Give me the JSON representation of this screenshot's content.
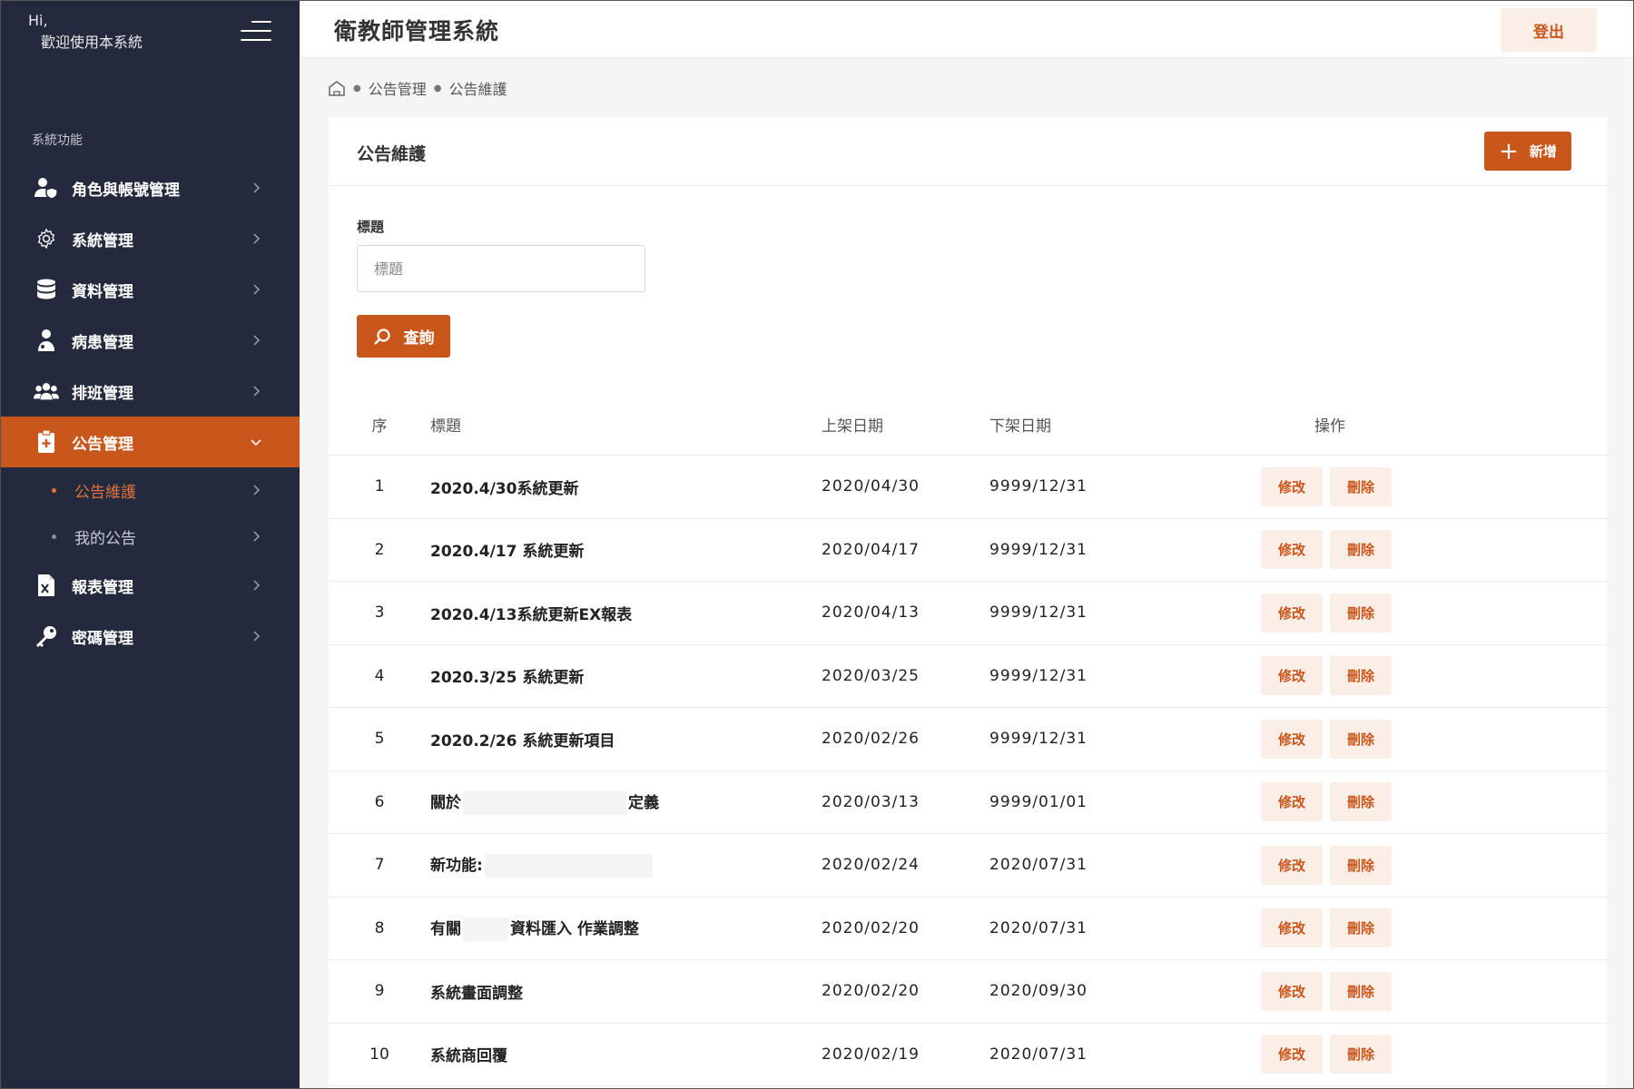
{
  "sidebar": {
    "greeting_line1": "Hi,",
    "greeting_line2": "歡迎使用本系統",
    "section_label": "系統功能",
    "items": [
      {
        "label": "角色與帳號管理",
        "icon": "user-shield-icon"
      },
      {
        "label": "系統管理",
        "icon": "gear-icon"
      },
      {
        "label": "資料管理",
        "icon": "database-icon"
      },
      {
        "label": "病患管理",
        "icon": "patient-icon"
      },
      {
        "label": "排班管理",
        "icon": "users-icon"
      },
      {
        "label": "公告管理",
        "icon": "clipboard-plus-icon"
      },
      {
        "label": "報表管理",
        "icon": "excel-file-icon"
      },
      {
        "label": "密碼管理",
        "icon": "key-icon"
      }
    ],
    "subitems": [
      {
        "label": "公告維護"
      },
      {
        "label": "我的公告"
      }
    ]
  },
  "header": {
    "title": "衛教師管理系統",
    "logout_label": "登出"
  },
  "breadcrumb": {
    "items": [
      "公告管理",
      "公告維護"
    ]
  },
  "card": {
    "title": "公告維護",
    "add_label": "新增",
    "field_label": "標題",
    "input_placeholder": "標題",
    "search_label": "查詢"
  },
  "table": {
    "headers": [
      "序",
      "標題",
      "上架日期",
      "下架日期",
      "操作"
    ],
    "edit_label": "修改",
    "delete_label": "刪除",
    "rows": [
      {
        "no": "1",
        "title_a": "2020.4/30系統更新",
        "title_b": "",
        "start": "2020/04/30",
        "end": "9999/12/31"
      },
      {
        "no": "2",
        "title_a": "2020.4/17 系統更新",
        "title_b": "",
        "start": "2020/04/17",
        "end": "9999/12/31"
      },
      {
        "no": "3",
        "title_a": "2020.4/13系統更新EX報表",
        "title_b": "",
        "start": "2020/04/13",
        "end": "9999/12/31"
      },
      {
        "no": "4",
        "title_a": "2020.3/25 系統更新",
        "title_b": "",
        "start": "2020/03/25",
        "end": "9999/12/31"
      },
      {
        "no": "5",
        "title_a": "2020.2/26 系統更新項目",
        "title_b": "",
        "start": "2020/02/26",
        "end": "9999/12/31"
      },
      {
        "no": "6",
        "title_a": "關於",
        "title_b": "定義",
        "start": "2020/03/13",
        "end": "9999/01/01"
      },
      {
        "no": "7",
        "title_a": "新功能:",
        "title_b": "",
        "start": "2020/02/24",
        "end": "2020/07/31"
      },
      {
        "no": "8",
        "title_a": "有關",
        "title_b": "資料匯入 作業調整",
        "start": "2020/02/20",
        "end": "2020/07/31"
      },
      {
        "no": "9",
        "title_a": "系統畫面調整",
        "title_b": "",
        "start": "2020/02/20",
        "end": "2020/09/30"
      },
      {
        "no": "10",
        "title_a": "系統商回覆",
        "title_b": "",
        "start": "2020/02/19",
        "end": "2020/07/31"
      }
    ]
  },
  "colors": {
    "accent": "#c9561b",
    "sidebar_bg": "#242a3d",
    "action_bg": "#fbeee6"
  }
}
